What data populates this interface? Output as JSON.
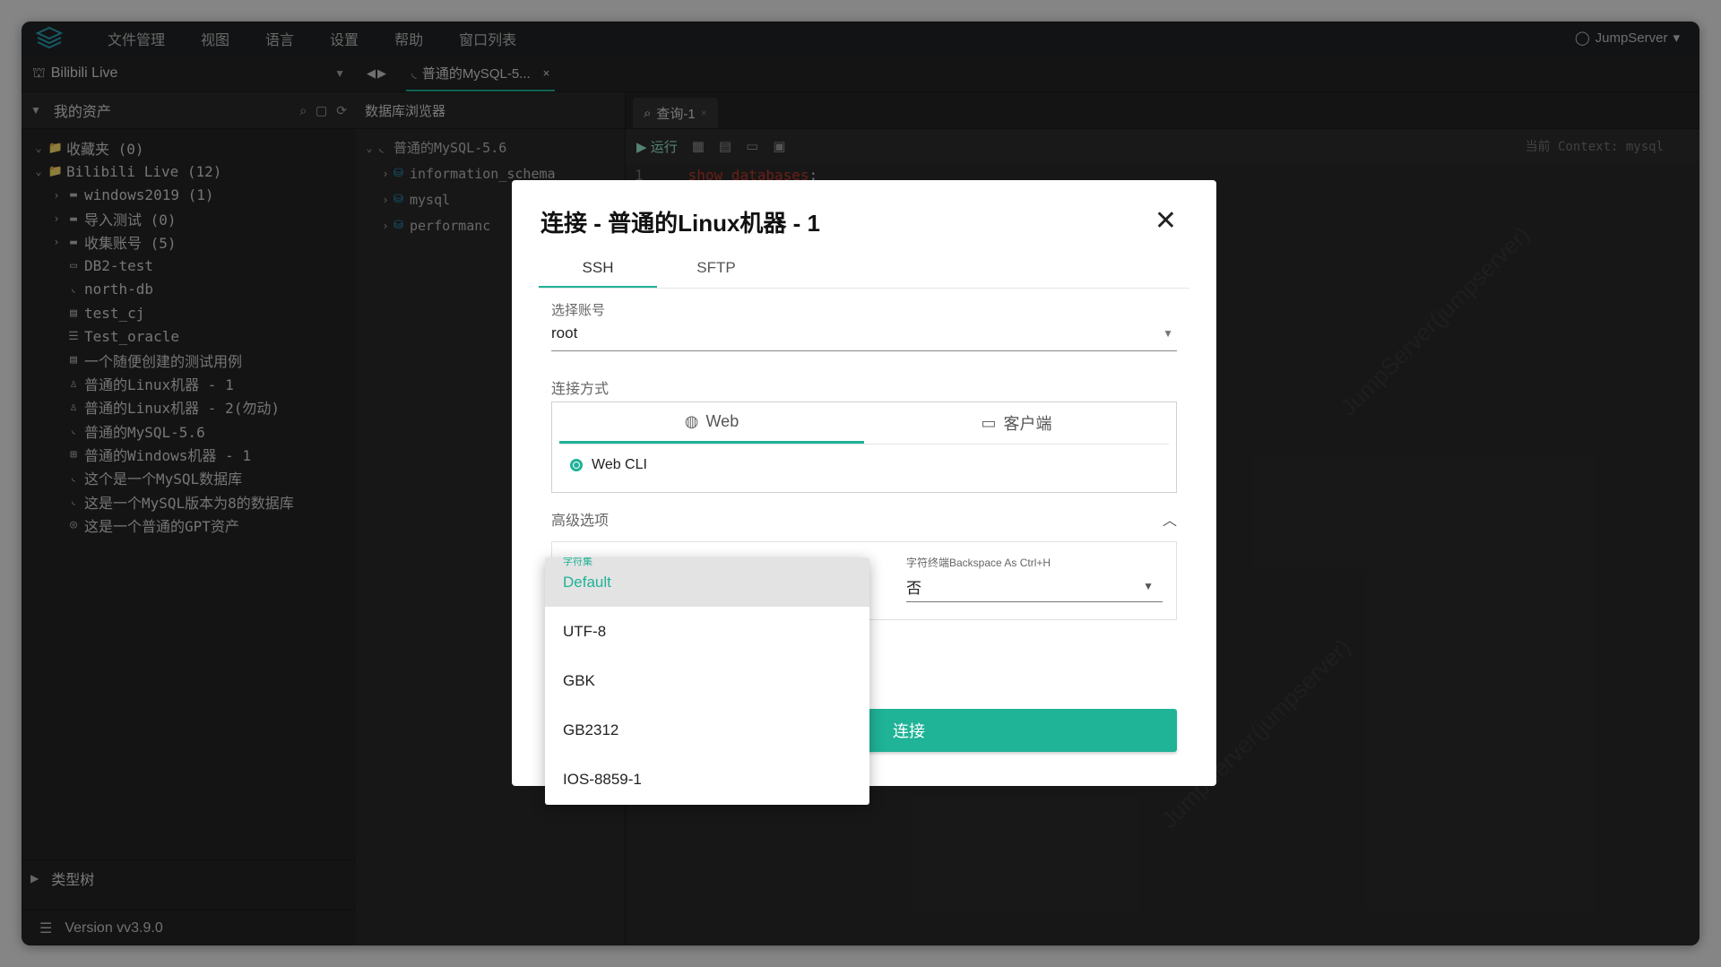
{
  "menu": [
    "文件管理",
    "视图",
    "语言",
    "设置",
    "帮助",
    "窗口列表"
  ],
  "user": {
    "name": "JumpServer",
    "caret": "▾"
  },
  "sidebar": {
    "org": "Bilibili Live",
    "assets_title": "我的资产",
    "tree": [
      {
        "arrow": "⌄",
        "icon": "📁",
        "label": "收藏夹 (0)",
        "indent": 0
      },
      {
        "arrow": "⌄",
        "icon": "📁",
        "label": "Bilibili Live (12)",
        "indent": 0
      },
      {
        "arrow": "›",
        "icon": "▬",
        "label": "windows2019 (1)",
        "indent": 1
      },
      {
        "arrow": "›",
        "icon": "▬",
        "label": "导入测试 (0)",
        "indent": 1
      },
      {
        "arrow": "›",
        "icon": "▬",
        "label": "收集账号 (5)",
        "indent": 1
      },
      {
        "arrow": "",
        "icon": "▭",
        "label": "DB2-test",
        "indent": 1
      },
      {
        "arrow": "",
        "icon": "◟",
        "label": "north-db",
        "indent": 1
      },
      {
        "arrow": "",
        "icon": "▤",
        "label": "test_cj",
        "indent": 1
      },
      {
        "arrow": "",
        "icon": "☰",
        "label": "Test_oracle",
        "indent": 1
      },
      {
        "arrow": "",
        "icon": "▤",
        "label": "一个随便创建的测试用例",
        "indent": 1
      },
      {
        "arrow": "",
        "icon": "♙",
        "label": "普通的Linux机器 - 1",
        "indent": 1
      },
      {
        "arrow": "",
        "icon": "♙",
        "label": "普通的Linux机器 - 2(勿动)",
        "indent": 1
      },
      {
        "arrow": "",
        "icon": "◟",
        "label": "普通的MySQL-5.6",
        "indent": 1
      },
      {
        "arrow": "",
        "icon": "⊞",
        "label": "普通的Windows机器 - 1",
        "indent": 1
      },
      {
        "arrow": "",
        "icon": "◟",
        "label": "这个是一个MySQL数据库",
        "indent": 1
      },
      {
        "arrow": "",
        "icon": "◟",
        "label": "这是一个MySQL版本为8的数据库",
        "indent": 1
      },
      {
        "arrow": "",
        "icon": "◎",
        "label": "这是一个普通的GPT资产",
        "indent": 1
      }
    ],
    "type_tree": "类型树",
    "version": "Version vv3.9.0"
  },
  "tabbar": {
    "tab_label": "普通的MySQL-5...",
    "close": "×"
  },
  "db_browser": {
    "title": "数据库浏览器",
    "root": "普通的MySQL-5.6",
    "items": [
      "information_schema",
      "mysql",
      "performanc"
    ]
  },
  "editor": {
    "query_tab": "查询-1",
    "run": "运行",
    "context": "当前 Context: mysql",
    "line_no": "1",
    "code_kw": "show databases",
    "code_end": ";"
  },
  "dialog": {
    "title": "连接 - 普通的Linux机器 - 1",
    "close": "✕",
    "tabs": [
      "SSH",
      "SFTP"
    ],
    "account_label": "选择账号",
    "account_value": "root",
    "method_label": "连接方式",
    "method_tabs": [
      "Web",
      "客户端"
    ],
    "radio_label": "Web CLI",
    "advanced_label": "高级选项",
    "charset_label": "字符集",
    "backspace_label": "字符终端Backspace As Ctrl+H",
    "backspace_value": "否",
    "connect_button": "连接"
  },
  "charset_dropdown": {
    "options": [
      "Default",
      "UTF-8",
      "GBK",
      "GB2312",
      "IOS-8859-1"
    ],
    "selected": "Default"
  },
  "colors": {
    "accent": "#1fb397",
    "dark_bg": "#2b2b2b"
  }
}
